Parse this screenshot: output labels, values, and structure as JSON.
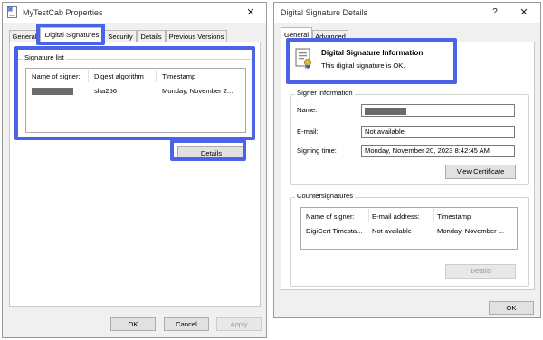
{
  "props_window": {
    "title": "MyTestCab Properties",
    "close_glyph": "✕",
    "tabs": [
      {
        "label": "General"
      },
      {
        "label": "Digital Signatures"
      },
      {
        "label": "Security"
      },
      {
        "label": "Details"
      },
      {
        "label": "Previous Versions"
      }
    ],
    "signature_list": {
      "label": "Signature list",
      "columns": [
        "Name of signer:",
        "Digest algorithm",
        "Timestamp"
      ],
      "rows": [
        {
          "signer": "",
          "digest": "sha256",
          "timestamp": "Monday, November 2..."
        }
      ]
    },
    "details_button": "Details",
    "ok_button": "OK",
    "cancel_button": "Cancel",
    "apply_button": "Apply"
  },
  "details_window": {
    "title": "Digital Signature Details",
    "help_glyph": "?",
    "close_glyph": "✕",
    "tabs": [
      {
        "label": "General"
      },
      {
        "label": "Advanced"
      }
    ],
    "info": {
      "heading": "Digital Signature Information",
      "status": "This digital signature is OK."
    },
    "signer_information": {
      "label": "Signer information",
      "name_label": "Name:",
      "email_label": "E-mail:",
      "email_value": "Not available",
      "signing_time_label": "Signing time:",
      "signing_time_value": "Monday, November 20, 2023 8:42:45 AM",
      "view_certificate_button": "View Certificate"
    },
    "countersignatures": {
      "label": "Countersignatures",
      "columns": [
        "Name of signer:",
        "E-mail address:",
        "Timestamp"
      ],
      "rows": [
        {
          "signer": "DigiCert Timesta...",
          "email": "Not available",
          "timestamp": "Monday, November ..."
        }
      ],
      "details_button": "Details"
    },
    "ok_button": "OK"
  },
  "colors": {
    "highlight": "#4b63e6",
    "window_bg": "#f0f0f0"
  }
}
